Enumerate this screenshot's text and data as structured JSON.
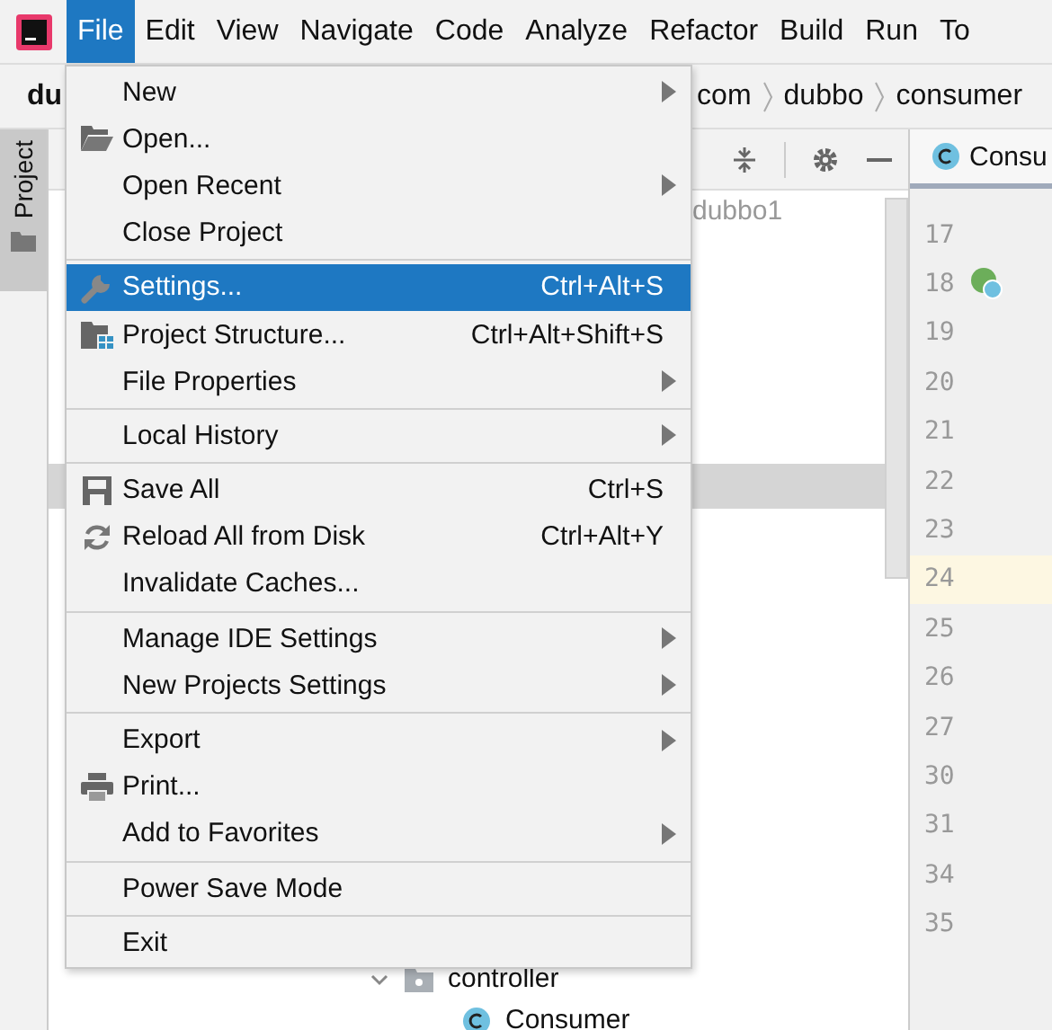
{
  "menubar": [
    {
      "label": "File",
      "selected": true
    },
    {
      "label": "Edit",
      "selected": false
    },
    {
      "label": "View",
      "selected": false
    },
    {
      "label": "Navigate",
      "selected": false
    },
    {
      "label": "Code",
      "selected": false
    },
    {
      "label": "Analyze",
      "selected": false
    },
    {
      "label": "Refactor",
      "selected": false
    },
    {
      "label": "Build",
      "selected": false
    },
    {
      "label": "Run",
      "selected": false
    },
    {
      "label": "To",
      "selected": false
    }
  ],
  "navbar": {
    "project": "du",
    "breadcrumbs": [
      "com",
      "dubbo",
      "consumer"
    ]
  },
  "side_tab": "Project",
  "project_panel": {
    "root": "dubbo1",
    "tree": [
      {
        "label": "controller",
        "kind": "folder",
        "expanded": true,
        "children": [
          {
            "label": "Consumer",
            "kind": "class"
          }
        ]
      }
    ]
  },
  "editor": {
    "tab": "Consu",
    "lines": [
      {
        "number": "17",
        "current": false
      },
      {
        "number": "18",
        "current": false,
        "marker": true
      },
      {
        "number": "19",
        "current": false
      },
      {
        "number": "20",
        "current": false
      },
      {
        "number": "21",
        "current": false
      },
      {
        "number": "22",
        "current": false
      },
      {
        "number": "23",
        "current": false
      },
      {
        "number": "24",
        "current": true
      },
      {
        "number": "25",
        "current": false
      },
      {
        "number": "26",
        "current": false
      },
      {
        "number": "27",
        "current": false
      },
      {
        "number": "30",
        "current": false
      },
      {
        "number": "31",
        "current": false
      },
      {
        "number": "34",
        "current": false
      },
      {
        "number": "35",
        "current": false
      }
    ]
  },
  "menu": {
    "groups": [
      [
        {
          "label": "New",
          "kind": "submenu",
          "selected": false
        },
        {
          "label": "Open...",
          "kind": "folder",
          "selected": false
        },
        {
          "label": "Open Recent",
          "kind": "submenu",
          "selected": false
        },
        {
          "label": "Close Project",
          "kind": "plain",
          "selected": false
        }
      ],
      [
        {
          "label": "Settings...",
          "kind": "wrench",
          "shortcut": "Ctrl+Alt+S",
          "selected": true
        },
        {
          "label": "Project Structure...",
          "kind": "structure",
          "shortcut": "Ctrl+Alt+Shift+S",
          "selected": false
        },
        {
          "label": "File Properties",
          "kind": "submenu",
          "selected": false
        }
      ],
      [
        {
          "label": "Local History",
          "kind": "submenu",
          "selected": false
        }
      ],
      [
        {
          "label": "Save All",
          "kind": "save",
          "shortcut": "Ctrl+S",
          "selected": false
        },
        {
          "label": "Reload All from Disk",
          "kind": "reload",
          "shortcut": "Ctrl+Alt+Y",
          "selected": false
        },
        {
          "label": "Invalidate Caches...",
          "kind": "plain",
          "selected": false
        }
      ],
      [
        {
          "label": "Manage IDE Settings",
          "kind": "submenu",
          "selected": false
        },
        {
          "label": "New Projects Settings",
          "kind": "submenu",
          "selected": false
        }
      ],
      [
        {
          "label": "Export",
          "kind": "submenu",
          "selected": false
        },
        {
          "label": "Print...",
          "kind": "print",
          "selected": false
        },
        {
          "label": "Add to Favorites",
          "kind": "submenu",
          "selected": false
        }
      ],
      [
        {
          "label": "Power Save Mode",
          "kind": "plain",
          "selected": false
        }
      ],
      [
        {
          "label": "Exit",
          "kind": "plain",
          "selected": false
        }
      ]
    ]
  }
}
